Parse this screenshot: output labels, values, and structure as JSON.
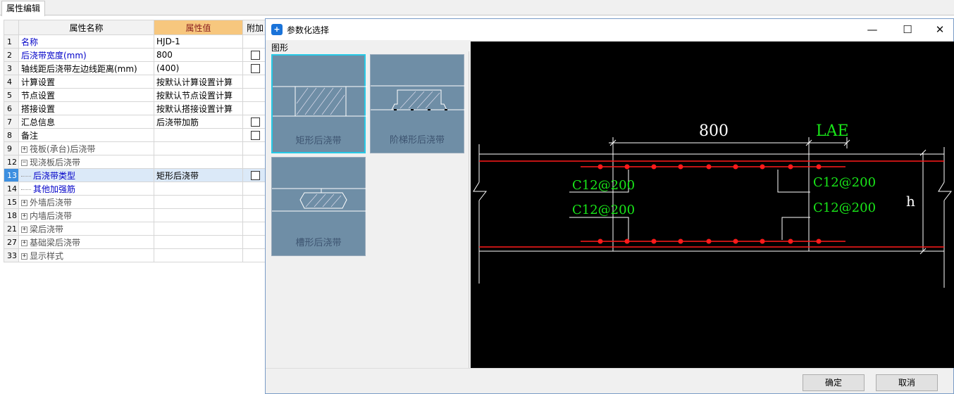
{
  "panel": {
    "tab": "属性编辑"
  },
  "grid": {
    "headers": {
      "name": "属性名称",
      "value": "属性值",
      "extra": "附加"
    },
    "rows": [
      {
        "n": "1",
        "name": "名称",
        "value": "HJD-1",
        "style": "blue",
        "cb": false
      },
      {
        "n": "2",
        "name": "后浇带宽度(mm)",
        "value": "800",
        "style": "blue",
        "cb": true
      },
      {
        "n": "3",
        "name": "轴线距后浇带左边线距离(mm)",
        "value": "(400)",
        "style": "",
        "cb": true
      },
      {
        "n": "4",
        "name": "计算设置",
        "value": "按默认计算设置计算",
        "style": "",
        "cb": false
      },
      {
        "n": "5",
        "name": "节点设置",
        "value": "按默认节点设置计算",
        "style": "",
        "cb": false
      },
      {
        "n": "6",
        "name": "搭接设置",
        "value": "按默认搭接设置计算",
        "style": "",
        "cb": false
      },
      {
        "n": "7",
        "name": "汇总信息",
        "value": "后浇带加筋",
        "style": "",
        "cb": true
      },
      {
        "n": "8",
        "name": "备注",
        "value": "",
        "style": "",
        "cb": true
      },
      {
        "n": "9",
        "name": "筏板(承台)后浇带",
        "value": "",
        "style": "gray",
        "tree": "+",
        "cb": false
      },
      {
        "n": "12",
        "name": "现浇板后浇带",
        "value": "",
        "style": "gray",
        "tree": "-",
        "cb": false
      },
      {
        "n": "13",
        "name": "后浇带类型",
        "value": "矩形后浇带",
        "style": "blue",
        "tree": "line",
        "cb": true,
        "selected": true
      },
      {
        "n": "14",
        "name": "其他加强筋",
        "value": "",
        "style": "blue",
        "tree": "line",
        "cb": false
      },
      {
        "n": "15",
        "name": "外墙后浇带",
        "value": "",
        "style": "gray",
        "tree": "+",
        "cb": false
      },
      {
        "n": "18",
        "name": "内墙后浇带",
        "value": "",
        "style": "gray",
        "tree": "+",
        "cb": false
      },
      {
        "n": "21",
        "name": "梁后浇带",
        "value": "",
        "style": "gray",
        "tree": "+",
        "cb": false
      },
      {
        "n": "27",
        "name": "基础梁后浇带",
        "value": "",
        "style": "gray",
        "tree": "+",
        "cb": false
      },
      {
        "n": "33",
        "name": "显示样式",
        "value": "",
        "style": "gray",
        "tree": "+",
        "cb": false
      }
    ]
  },
  "dialog": {
    "title": "参数化选择",
    "group": "图形",
    "shapes": [
      {
        "label": "矩形后浇带",
        "selected": true
      },
      {
        "label": "阶梯形后浇带",
        "selected": false
      },
      {
        "label": "槽形后浇带",
        "selected": false
      }
    ],
    "drawing": {
      "width_dim": "800",
      "lap_label": "LAE",
      "height_label": "h",
      "rebar_top_left": "C12@200",
      "rebar_top_right": "C12@200",
      "rebar_bottom_left": "C12@200",
      "rebar_bottom_right": "C12@200"
    },
    "ok": "确定",
    "cancel": "取消",
    "colors": {
      "rebar": "#ff1a1a",
      "text": "#19e619",
      "line": "#ffffff",
      "tile": "#6f8ea6",
      "tile_selected_border": "#27c9e6"
    }
  }
}
